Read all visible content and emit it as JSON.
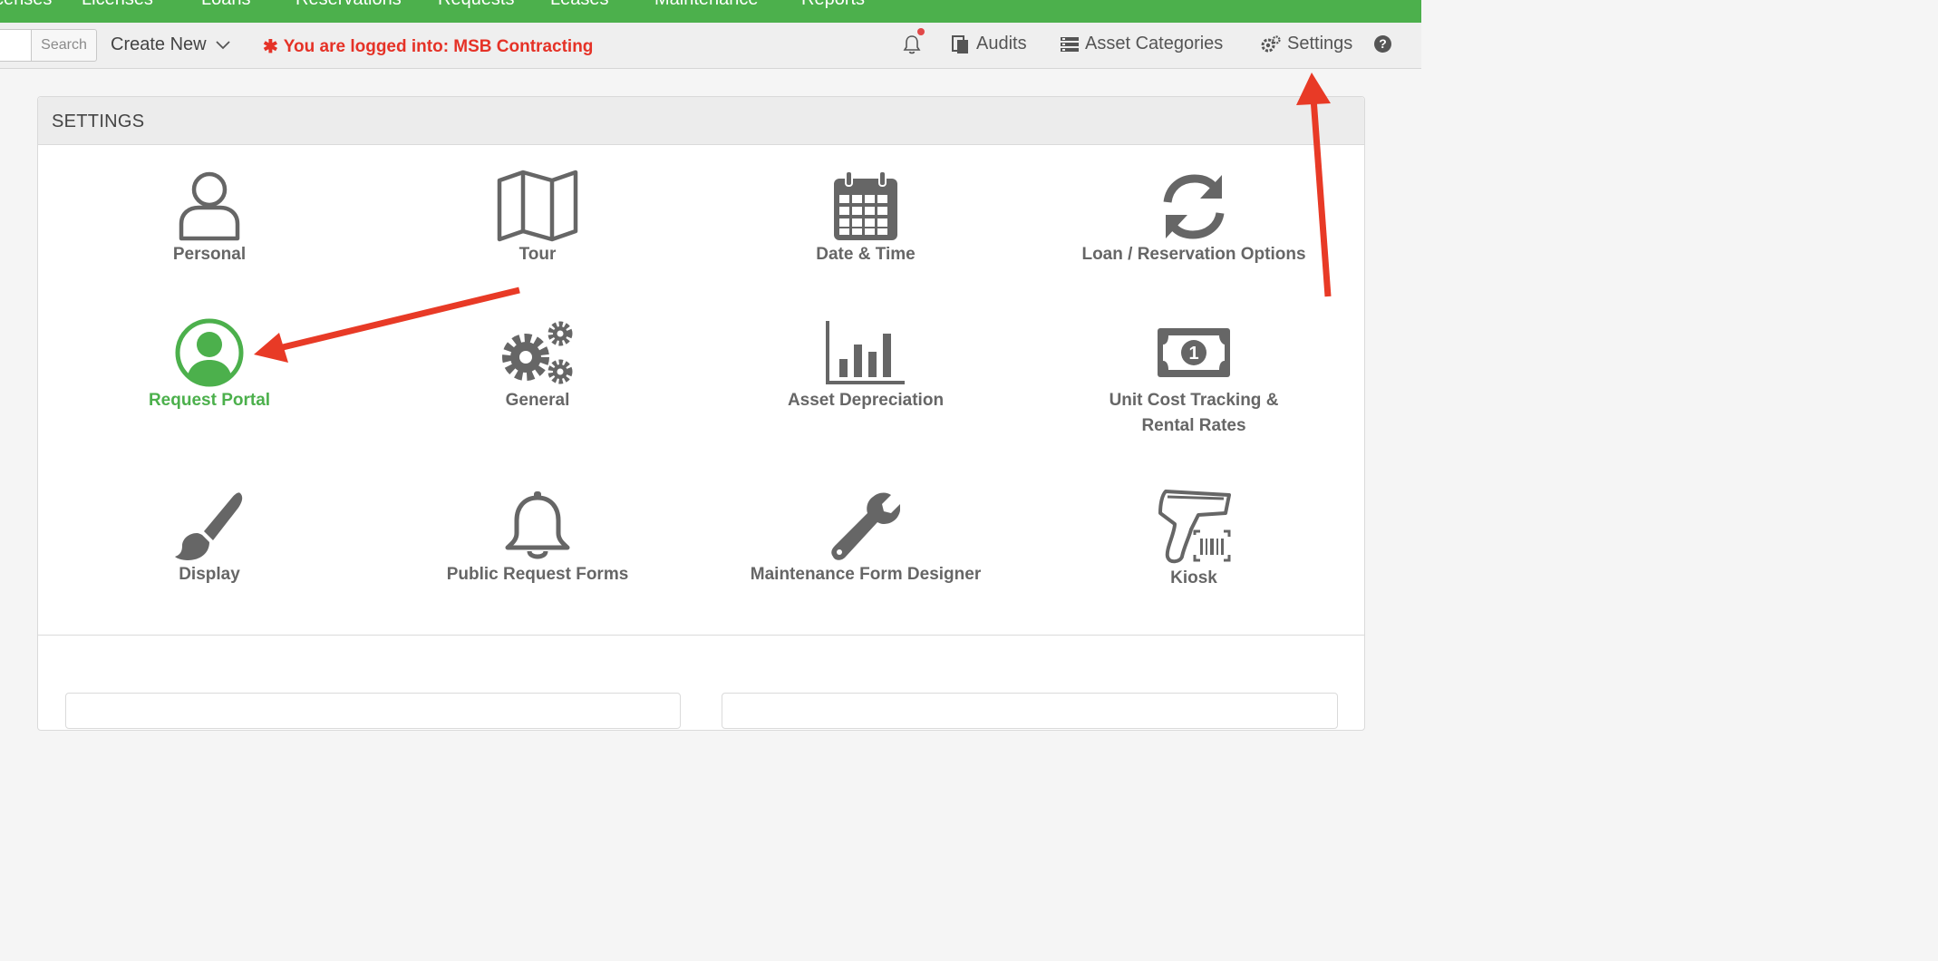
{
  "top_nav": {
    "items": [
      "censes",
      "Licenses",
      "Loans",
      "Reservations",
      "Requests",
      "Leases",
      "Maintenance",
      "Reports"
    ]
  },
  "toolbar": {
    "search_value": "",
    "search_button": "Search",
    "create_new": "Create New",
    "logged_in_text": "You are logged into: MSB Contracting",
    "audits": "Audits",
    "asset_categories": "Asset Categories",
    "settings": "Settings",
    "help": "?"
  },
  "settings": {
    "title": "SETTINGS",
    "tiles": [
      {
        "label": "Personal",
        "icon": "user-outline-icon"
      },
      {
        "label": "Tour",
        "icon": "map-icon"
      },
      {
        "label": "Date & Time",
        "icon": "calendar-icon"
      },
      {
        "label": "Loan / Reservation Options",
        "icon": "refresh-icon"
      },
      {
        "label": "Request Portal",
        "icon": "user-circle-icon",
        "active": true
      },
      {
        "label": "General",
        "icon": "gears-icon"
      },
      {
        "label": "Asset Depreciation",
        "icon": "bar-chart-icon"
      },
      {
        "label": "Unit Cost Tracking & Rental Rates",
        "label_line1": "Unit Cost Tracking &",
        "label_line2": "Rental Rates",
        "icon": "money-bill-icon"
      },
      {
        "label": "Display",
        "icon": "paint-brush-icon"
      },
      {
        "label": "Public Request Forms",
        "icon": "bell-icon"
      },
      {
        "label": "Maintenance Form Designer",
        "icon": "wrench-icon"
      },
      {
        "label": "Kiosk",
        "icon": "barcode-scanner-icon"
      }
    ]
  },
  "colors": {
    "brand_green": "#4cb04c",
    "alert_red": "#e53227",
    "icon_gray": "#666666"
  }
}
